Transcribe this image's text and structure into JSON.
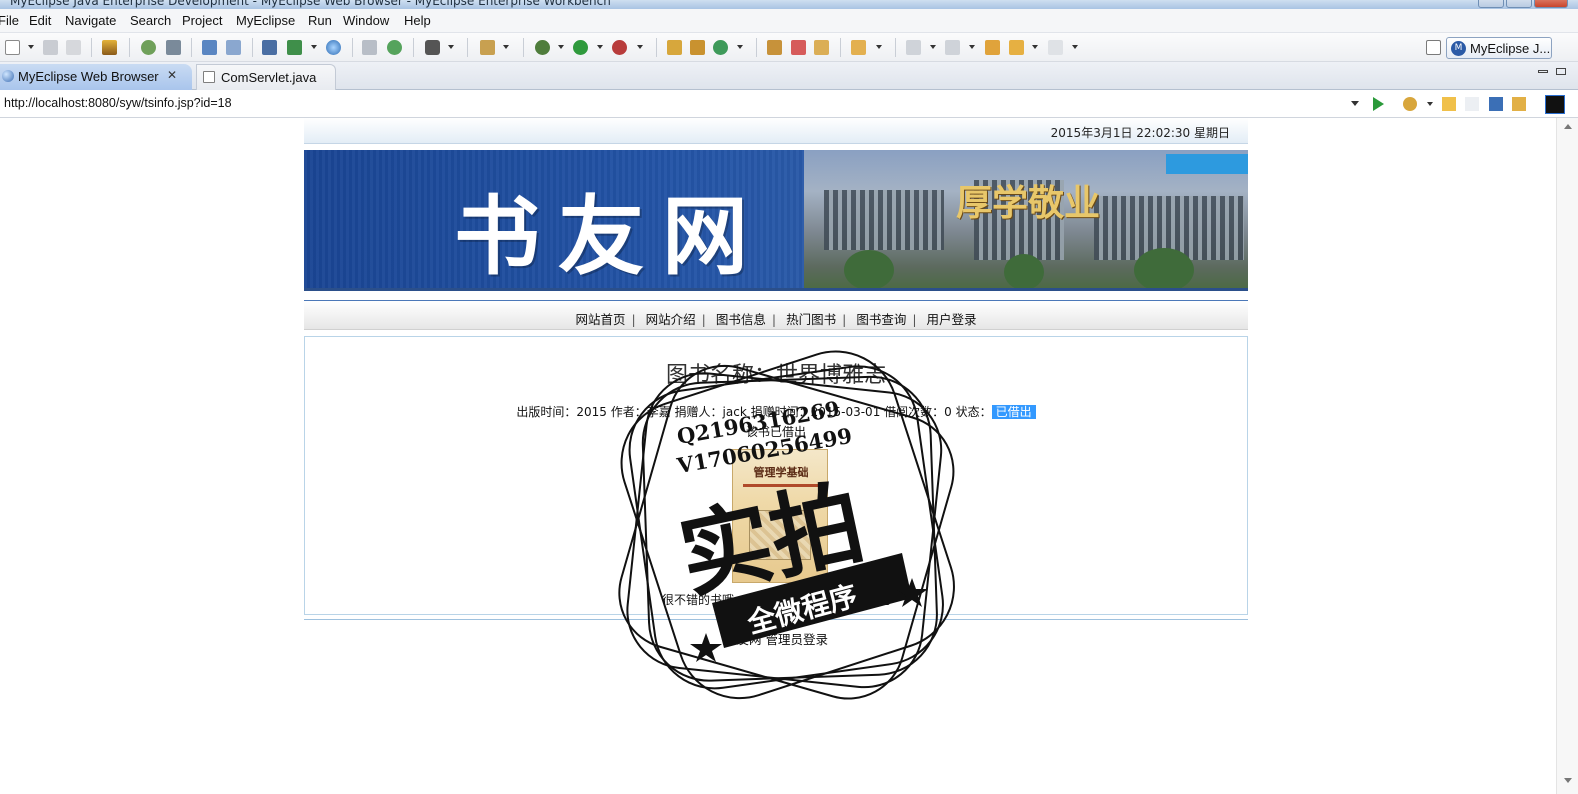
{
  "window": {
    "title": "MyEclipse Java Enterprise Development - MyEclipse Web Browser - MyEclipse Enterprise Workbench"
  },
  "menu": {
    "items": [
      "File",
      "Edit",
      "Navigate",
      "Search",
      "Project",
      "MyEclipse",
      "Run",
      "Window",
      "Help"
    ]
  },
  "toolbar": {
    "perspective_label": "MyEclipse J...",
    "perspective_icon": "myeclipse-perspective-icon"
  },
  "tabs": [
    {
      "label": "MyEclipse Web Browser",
      "close": "✕",
      "active": true,
      "icon": "browser-globe-icon"
    },
    {
      "label": "ComServlet.java",
      "active": false,
      "icon": "java-file-icon"
    }
  ],
  "address": {
    "url": "http://localhost:8080/syw/tsinfo.jsp?id=18"
  },
  "site": {
    "datetime": "2015年3月1日 22:02:30   星期日",
    "logo_text": "书友网",
    "motto": "厚学敬业",
    "nav": [
      "网站首页",
      "网站介绍",
      "图书信息",
      "热门图书",
      "图书查询",
      "用户登录"
    ],
    "nav_separator": "|"
  },
  "book": {
    "title": "图书名称：世界博雅志",
    "meta_prefix": "出版时间：2015  作者：李嘉  捐赠人：jack  捐赠时间：2015-03-01  借阅次数：0  状态：",
    "status": "已借出",
    "borrow_note": "该书已借出",
    "cover_title": "管理学基础",
    "description": "很不错的书哦，自己到后台编辑图书信息吧"
  },
  "footer": {
    "site": "书友网",
    "admin_login": "管理员登录"
  },
  "watermark": {
    "line1": "Q2196316269",
    "line2": "V17060256499",
    "big": "实拍",
    "ribbon": "全微程序"
  },
  "colors": {
    "status_bg": "#3399ff",
    "banner_blue": "#1f4d9c",
    "active_tab": "#b9d0ef",
    "motto_gold": "#e8c76a"
  }
}
